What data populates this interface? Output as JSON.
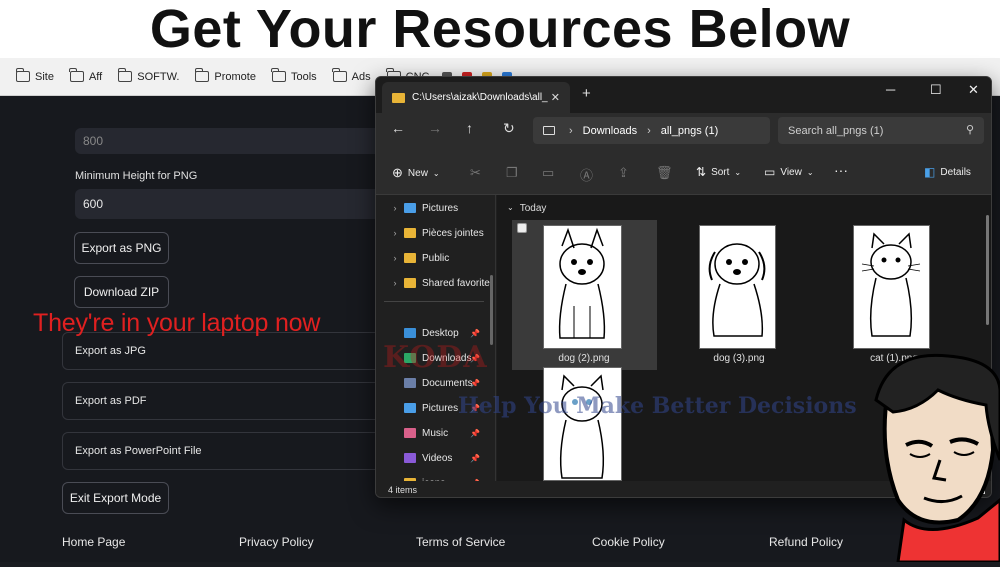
{
  "banner": {
    "title": "Get Your Resources Below"
  },
  "bookmarks": [
    {
      "label": "Site"
    },
    {
      "label": "Aff"
    },
    {
      "label": "SOFTW."
    },
    {
      "label": "Promote"
    },
    {
      "label": "Tools"
    },
    {
      "label": "Ads"
    },
    {
      "label": "CNC"
    }
  ],
  "form": {
    "top_value": "800",
    "min_height_label": "Minimum Height for PNG",
    "min_height_value": "600",
    "export_png_btn": "Export as PNG",
    "download_zip_btn": "Download ZIP",
    "export_jpg": "Export as JPG",
    "export_pdf": "Export as PDF",
    "export_ppt": "Export as PowerPoint File",
    "exit_btn": "Exit Export Mode"
  },
  "overlay_text": "They're in your laptop now",
  "footer": {
    "home": "Home Page",
    "privacy": "Privacy Policy",
    "terms": "Terms of Service",
    "cookie": "Cookie Policy",
    "refund": "Refund Policy"
  },
  "explorer": {
    "tab_title": "C:\\Users\\aizak\\Downloads\\all_",
    "breadcrumb": [
      "Downloads",
      "all_pngs (1)"
    ],
    "search_placeholder": "Search all_pngs (1)",
    "cmd": {
      "new": "New",
      "sort": "Sort",
      "view": "View",
      "details": "Details"
    },
    "nav_items": [
      {
        "label": "Pictures",
        "icon": "pictures-icon",
        "color": "#4a9ee8",
        "pinned": false,
        "arrow": true
      },
      {
        "label": "Pièces jointes",
        "icon": "folder-icon",
        "color": "#e8b437",
        "pinned": false,
        "arrow": true
      },
      {
        "label": "Public",
        "icon": "folder-icon",
        "color": "#e8b437",
        "pinned": false,
        "arrow": true
      },
      {
        "label": "Shared favorite",
        "icon": "folder-icon",
        "color": "#e8b437",
        "pinned": false,
        "arrow": true
      },
      {
        "label": "Desktop",
        "icon": "desktop-icon",
        "color": "#3a8fd8",
        "pinned": true,
        "arrow": false
      },
      {
        "label": "Downloads",
        "icon": "downloads-icon",
        "color": "#2aa866",
        "pinned": true,
        "arrow": false
      },
      {
        "label": "Documents",
        "icon": "documents-icon",
        "color": "#6b7fa8",
        "pinned": true,
        "arrow": false
      },
      {
        "label": "Pictures",
        "icon": "pictures-icon",
        "color": "#4a9ee8",
        "pinned": true,
        "arrow": false
      },
      {
        "label": "Music",
        "icon": "music-icon",
        "color": "#d8608a",
        "pinned": true,
        "arrow": false
      },
      {
        "label": "Videos",
        "icon": "videos-icon",
        "color": "#8a5ad8",
        "pinned": true,
        "arrow": false
      },
      {
        "label": "icons",
        "icon": "folder-icon",
        "color": "#e8b437",
        "pinned": true,
        "arrow": false
      }
    ],
    "group_header": "Today",
    "files": [
      {
        "name": "dog (2).png",
        "animal": "dog"
      },
      {
        "name": "dog (3).png",
        "animal": "puppy"
      },
      {
        "name": "cat (1).png",
        "animal": "cat"
      },
      {
        "name": "",
        "animal": "cat"
      }
    ],
    "status": "4 items"
  },
  "watermark": {
    "brand": "KODA",
    "tagline": "Help You Make Better Decisions"
  },
  "colors": {
    "accent_red": "#e02020",
    "folder_yellow": "#e8b437",
    "explorer_bg": "#202020"
  }
}
